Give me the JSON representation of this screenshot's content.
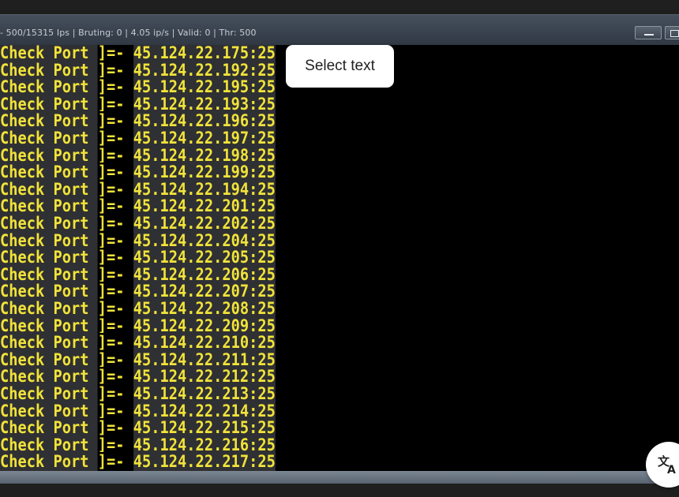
{
  "window": {
    "title": "- 500/15315 Ips | Bruting: 0 | 4.05 ip/s | Valid: 0 | Thr: 500"
  },
  "console": {
    "lines": [
      {
        "label": "Check Port ",
        "sep": "]=- ",
        "ip": "45.124.22.175:25"
      },
      {
        "label": "Check Port ",
        "sep": "]=- ",
        "ip": "45.124.22.192:25"
      },
      {
        "label": "Check Port ",
        "sep": "]=- ",
        "ip": "45.124.22.195:25"
      },
      {
        "label": "Check Port ",
        "sep": "]=- ",
        "ip": "45.124.22.193:25"
      },
      {
        "label": "Check Port ",
        "sep": "]=- ",
        "ip": "45.124.22.196:25"
      },
      {
        "label": "Check Port ",
        "sep": "]=- ",
        "ip": "45.124.22.197:25"
      },
      {
        "label": "Check Port ",
        "sep": "]=- ",
        "ip": "45.124.22.198:25"
      },
      {
        "label": "Check Port ",
        "sep": "]=- ",
        "ip": "45.124.22.199:25"
      },
      {
        "label": "Check Port ",
        "sep": "]=- ",
        "ip": "45.124.22.194:25"
      },
      {
        "label": "Check Port ",
        "sep": "]=- ",
        "ip": "45.124.22.201:25"
      },
      {
        "label": "Check Port ",
        "sep": "]=- ",
        "ip": "45.124.22.202:25"
      },
      {
        "label": "Check Port ",
        "sep": "]=- ",
        "ip": "45.124.22.204:25"
      },
      {
        "label": "Check Port ",
        "sep": "]=- ",
        "ip": "45.124.22.205:25"
      },
      {
        "label": "Check Port ",
        "sep": "]=- ",
        "ip": "45.124.22.206:25"
      },
      {
        "label": "Check Port ",
        "sep": "]=- ",
        "ip": "45.124.22.207:25"
      },
      {
        "label": "Check Port ",
        "sep": "]=- ",
        "ip": "45.124.22.208:25"
      },
      {
        "label": "Check Port ",
        "sep": "]=- ",
        "ip": "45.124.22.209:25"
      },
      {
        "label": "Check Port ",
        "sep": "]=- ",
        "ip": "45.124.22.210:25"
      },
      {
        "label": "Check Port ",
        "sep": "]=- ",
        "ip": "45.124.22.211:25"
      },
      {
        "label": "Check Port ",
        "sep": "]=- ",
        "ip": "45.124.22.212:25"
      },
      {
        "label": "Check Port ",
        "sep": "]=- ",
        "ip": "45.124.22.213:25"
      },
      {
        "label": "Check Port ",
        "sep": "]=- ",
        "ip": "45.124.22.214:25"
      },
      {
        "label": "Check Port ",
        "sep": "]=- ",
        "ip": "45.124.22.215:25"
      },
      {
        "label": "Check Port ",
        "sep": "]=- ",
        "ip": "45.124.22.216:25"
      },
      {
        "label": "Check Port ",
        "sep": "]=- ",
        "ip": "45.124.22.217:25"
      }
    ]
  },
  "overlay": {
    "select_text_label": "Select text",
    "translate_icon": "translate-icon"
  },
  "colors": {
    "console_text": "#f1e33a",
    "console_bg": "#000000",
    "highlight_bg": "#2f3033"
  }
}
